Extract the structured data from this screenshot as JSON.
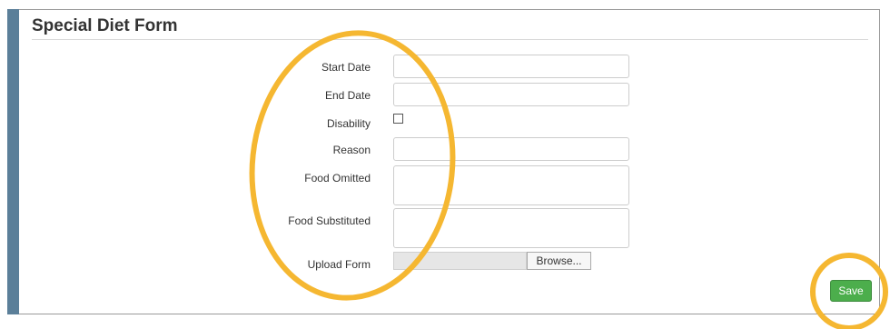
{
  "form": {
    "title": "Special Diet Form",
    "fields": {
      "start_date": {
        "label": "Start Date",
        "value": ""
      },
      "end_date": {
        "label": "End Date",
        "value": ""
      },
      "disability": {
        "label": "Disability",
        "checked": false
      },
      "reason": {
        "label": "Reason",
        "value": ""
      },
      "food_omitted": {
        "label": "Food Omitted",
        "value": ""
      },
      "food_substituted": {
        "label": "Food Substituted",
        "value": ""
      },
      "upload_form": {
        "label": "Upload Form",
        "button_label": "Browse..."
      }
    },
    "save_label": "Save"
  },
  "colors": {
    "sidebar": "#5b7f99",
    "save_button": "#4cae4c",
    "annotation": "#f5b731"
  }
}
